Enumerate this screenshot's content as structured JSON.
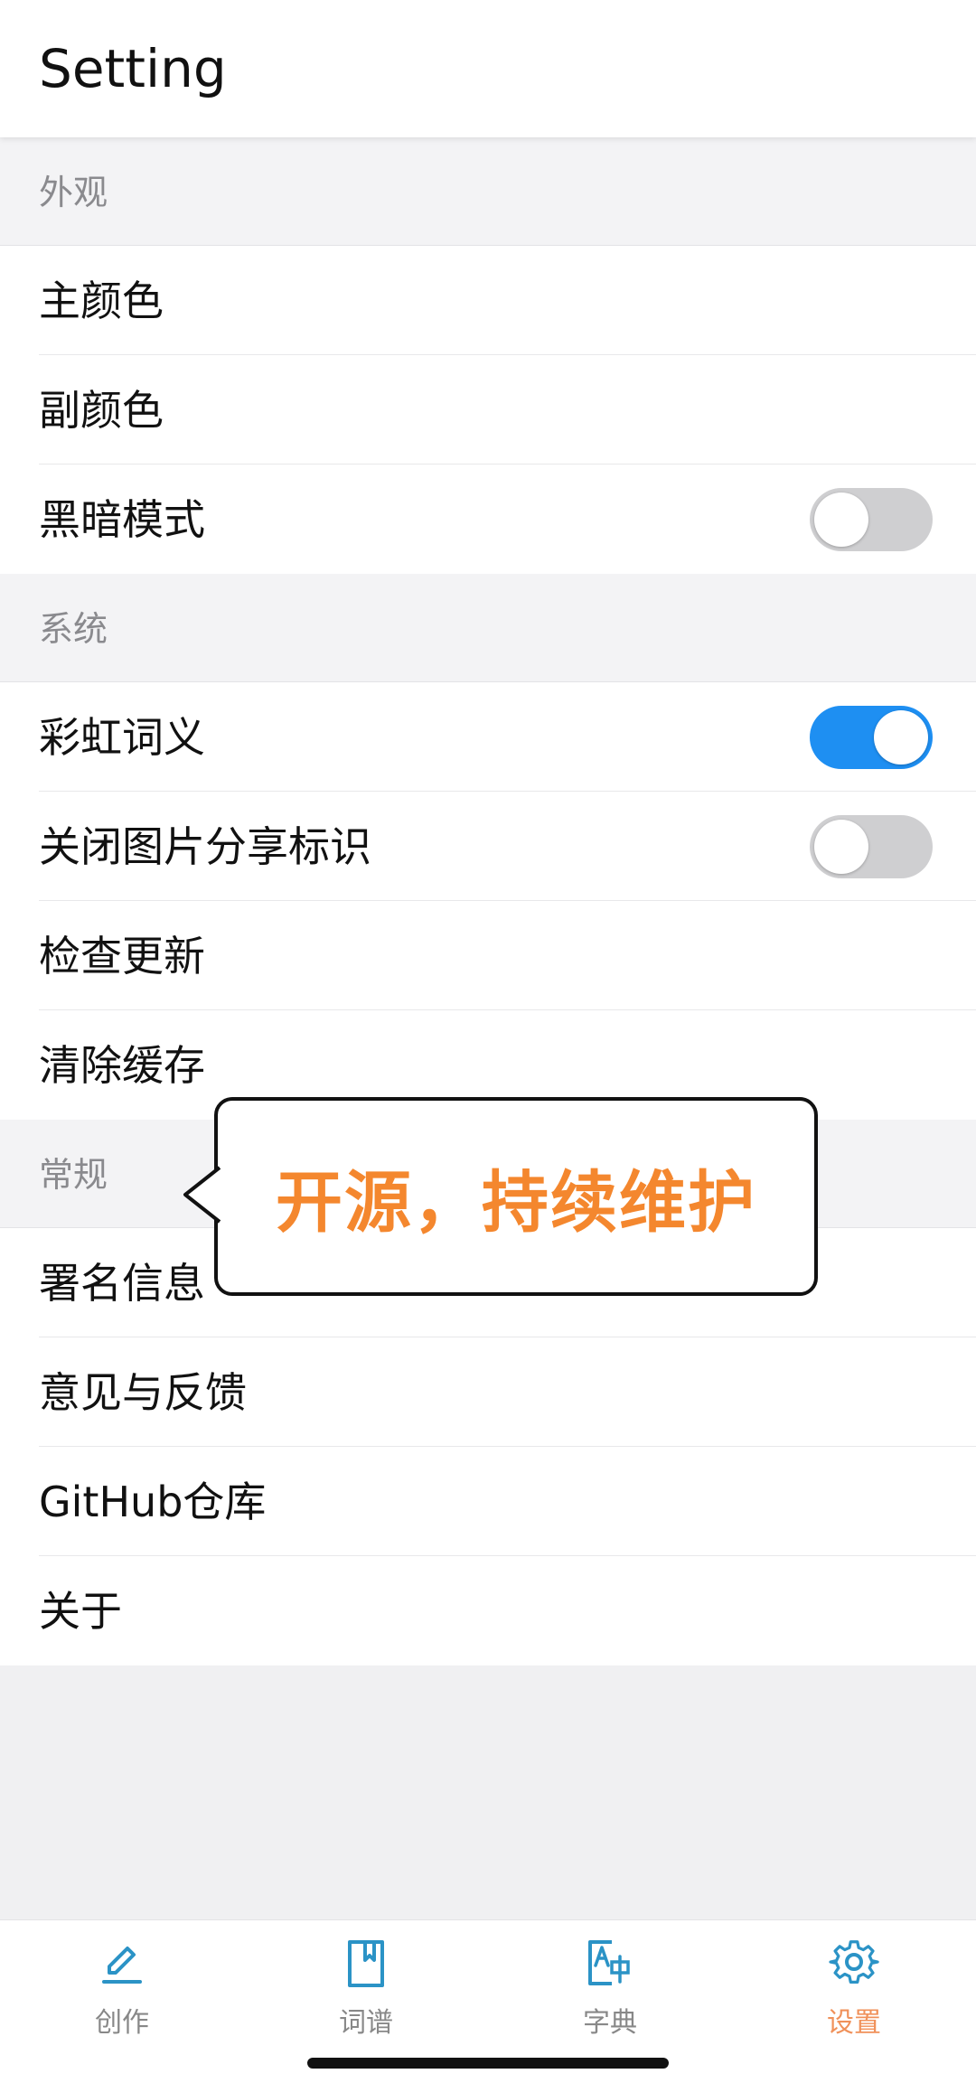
{
  "header": {
    "title": "Setting"
  },
  "sections": {
    "appearance": {
      "title": "外观",
      "primary_color": "主颜色",
      "secondary_color": "副颜色",
      "dark_mode": "黑暗模式"
    },
    "system": {
      "title": "系统",
      "rainbow_meaning": "彩虹词义",
      "close_share_mark": "关闭图片分享标识",
      "check_update": "检查更新",
      "clear_cache": "清除缓存"
    },
    "general": {
      "title": "常规",
      "signature_info": "署名信息",
      "feedback": "意见与反馈",
      "github_repo": "GitHub仓库",
      "about": "关于"
    }
  },
  "toggles": {
    "dark_mode": false,
    "rainbow_meaning": true,
    "close_share_mark": false
  },
  "callout": {
    "text": "开源，持续维护"
  },
  "tabs": [
    {
      "label": "创作",
      "icon": "pen-icon"
    },
    {
      "label": "词谱",
      "icon": "bookmark-icon"
    },
    {
      "label": "字典",
      "icon": "dictionary-icon"
    },
    {
      "label": "设置",
      "icon": "gear-icon"
    }
  ],
  "colors": {
    "accent_blue": "#1e8ff2",
    "tab_icon_blue": "#2b93c6",
    "active_tab_orange": "#f0915a",
    "callout_orange": "#f4872e"
  }
}
